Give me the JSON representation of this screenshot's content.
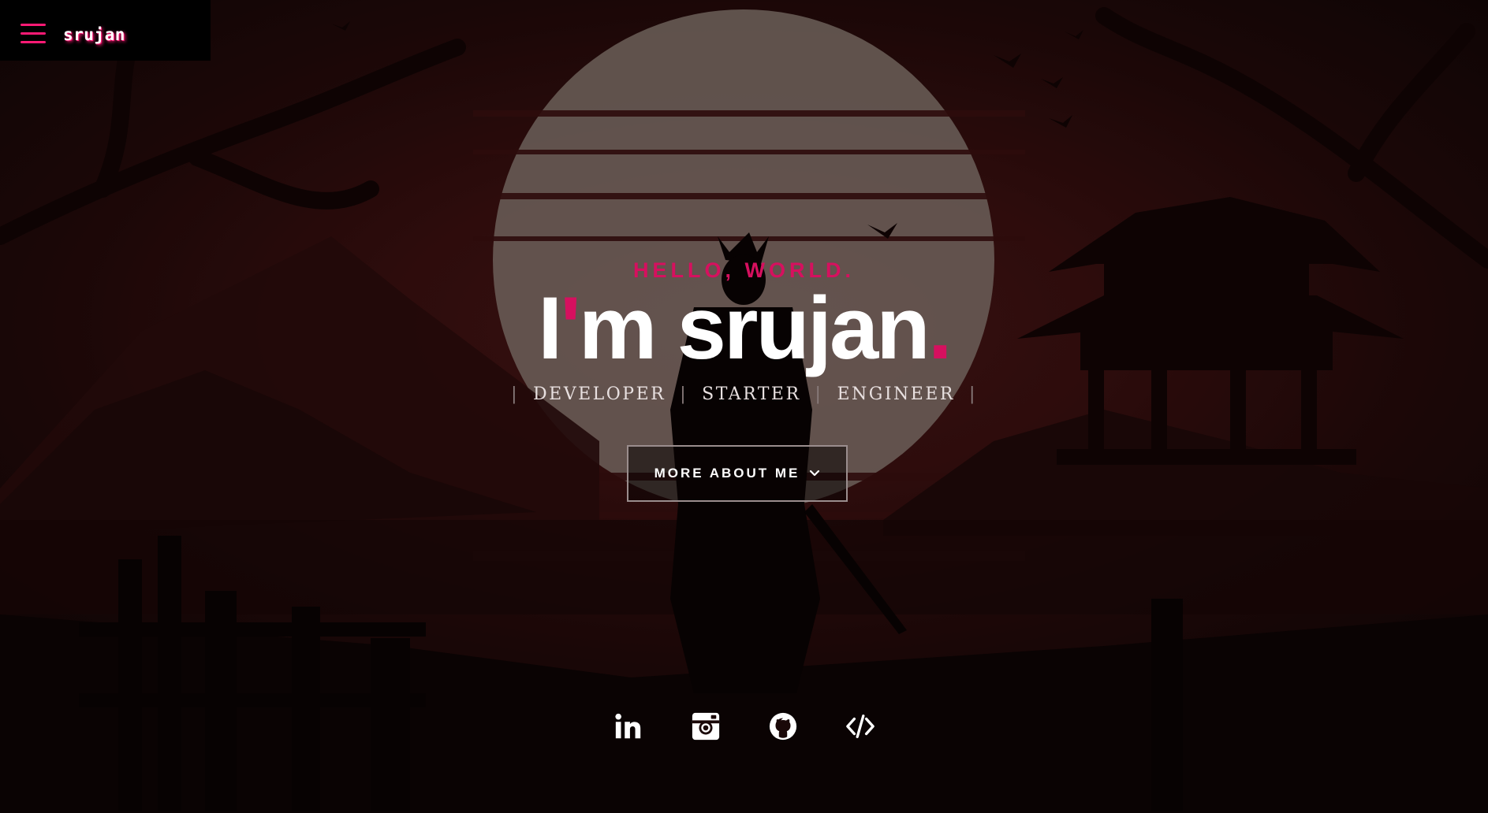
{
  "nav": {
    "brand": "srujan",
    "menu_icon": "hamburger-menu-icon",
    "accent_color": "#ff1a75"
  },
  "hero": {
    "greeting": "HELLO, WORLD.",
    "headline_prefix": "I",
    "headline_apostrophe": "'",
    "headline_main": "m srujan",
    "headline_dot": ".",
    "roles": [
      "DEVELOPER",
      "STARTER",
      "ENGINEER"
    ],
    "separator": "|",
    "cta_label": "MORE ABOUT ME",
    "cta_icon": "chevron-down-icon",
    "accent_color": "#d6105f"
  },
  "socials": [
    {
      "name": "linkedin",
      "icon": "linkedin-icon"
    },
    {
      "name": "instagram",
      "icon": "instagram-icon"
    },
    {
      "name": "github",
      "icon": "github-icon"
    },
    {
      "name": "code",
      "icon": "code-icon"
    }
  ]
}
